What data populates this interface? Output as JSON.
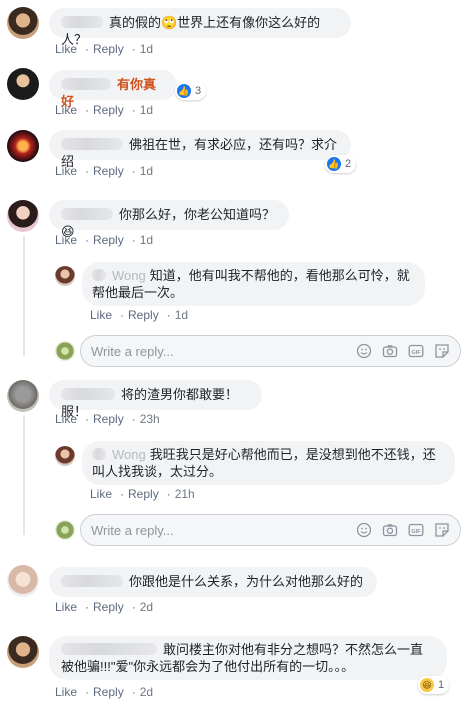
{
  "actions": {
    "like": "Like",
    "reply": "Reply"
  },
  "reply_placeholder": "Write a reply...",
  "comments": [
    {
      "id": "c1",
      "text": "真的假的🙄世界上还有像你这么好的人？",
      "time": "1d"
    },
    {
      "id": "c2",
      "text": "有你真好",
      "time": "1d",
      "reaction_count": "3"
    },
    {
      "id": "c3",
      "text": "佛祖在世，有求必应，还有吗？求介绍",
      "time": "1d",
      "reaction_count": "2"
    },
    {
      "id": "c4",
      "text": "你那么好，你老公知道吗？😆",
      "time": "1d",
      "reply": {
        "name": "Wong",
        "text": "知道，他有叫我不帮他的，看他那么可怜，就帮他最后一次。",
        "time": "1d"
      }
    },
    {
      "id": "c5",
      "text": "将的渣男你都敢要！服！",
      "time": "23h",
      "reply": {
        "name": "Wong",
        "text": "我旺我只是好心帮他而已，是没想到他不还钱，还叫人找我谈，太过分。",
        "time": "21h"
      }
    },
    {
      "id": "c6",
      "text": "你跟他是什么关系，为什么对他那么好的",
      "time": "2d"
    },
    {
      "id": "c7",
      "text": "敢问楼主你对他有非分之想吗？不然怎么一直被他骗!!!\"爱\"你永远都会为了他付出所有的一切。。。",
      "time": "2d",
      "reaction_count": "1"
    }
  ]
}
